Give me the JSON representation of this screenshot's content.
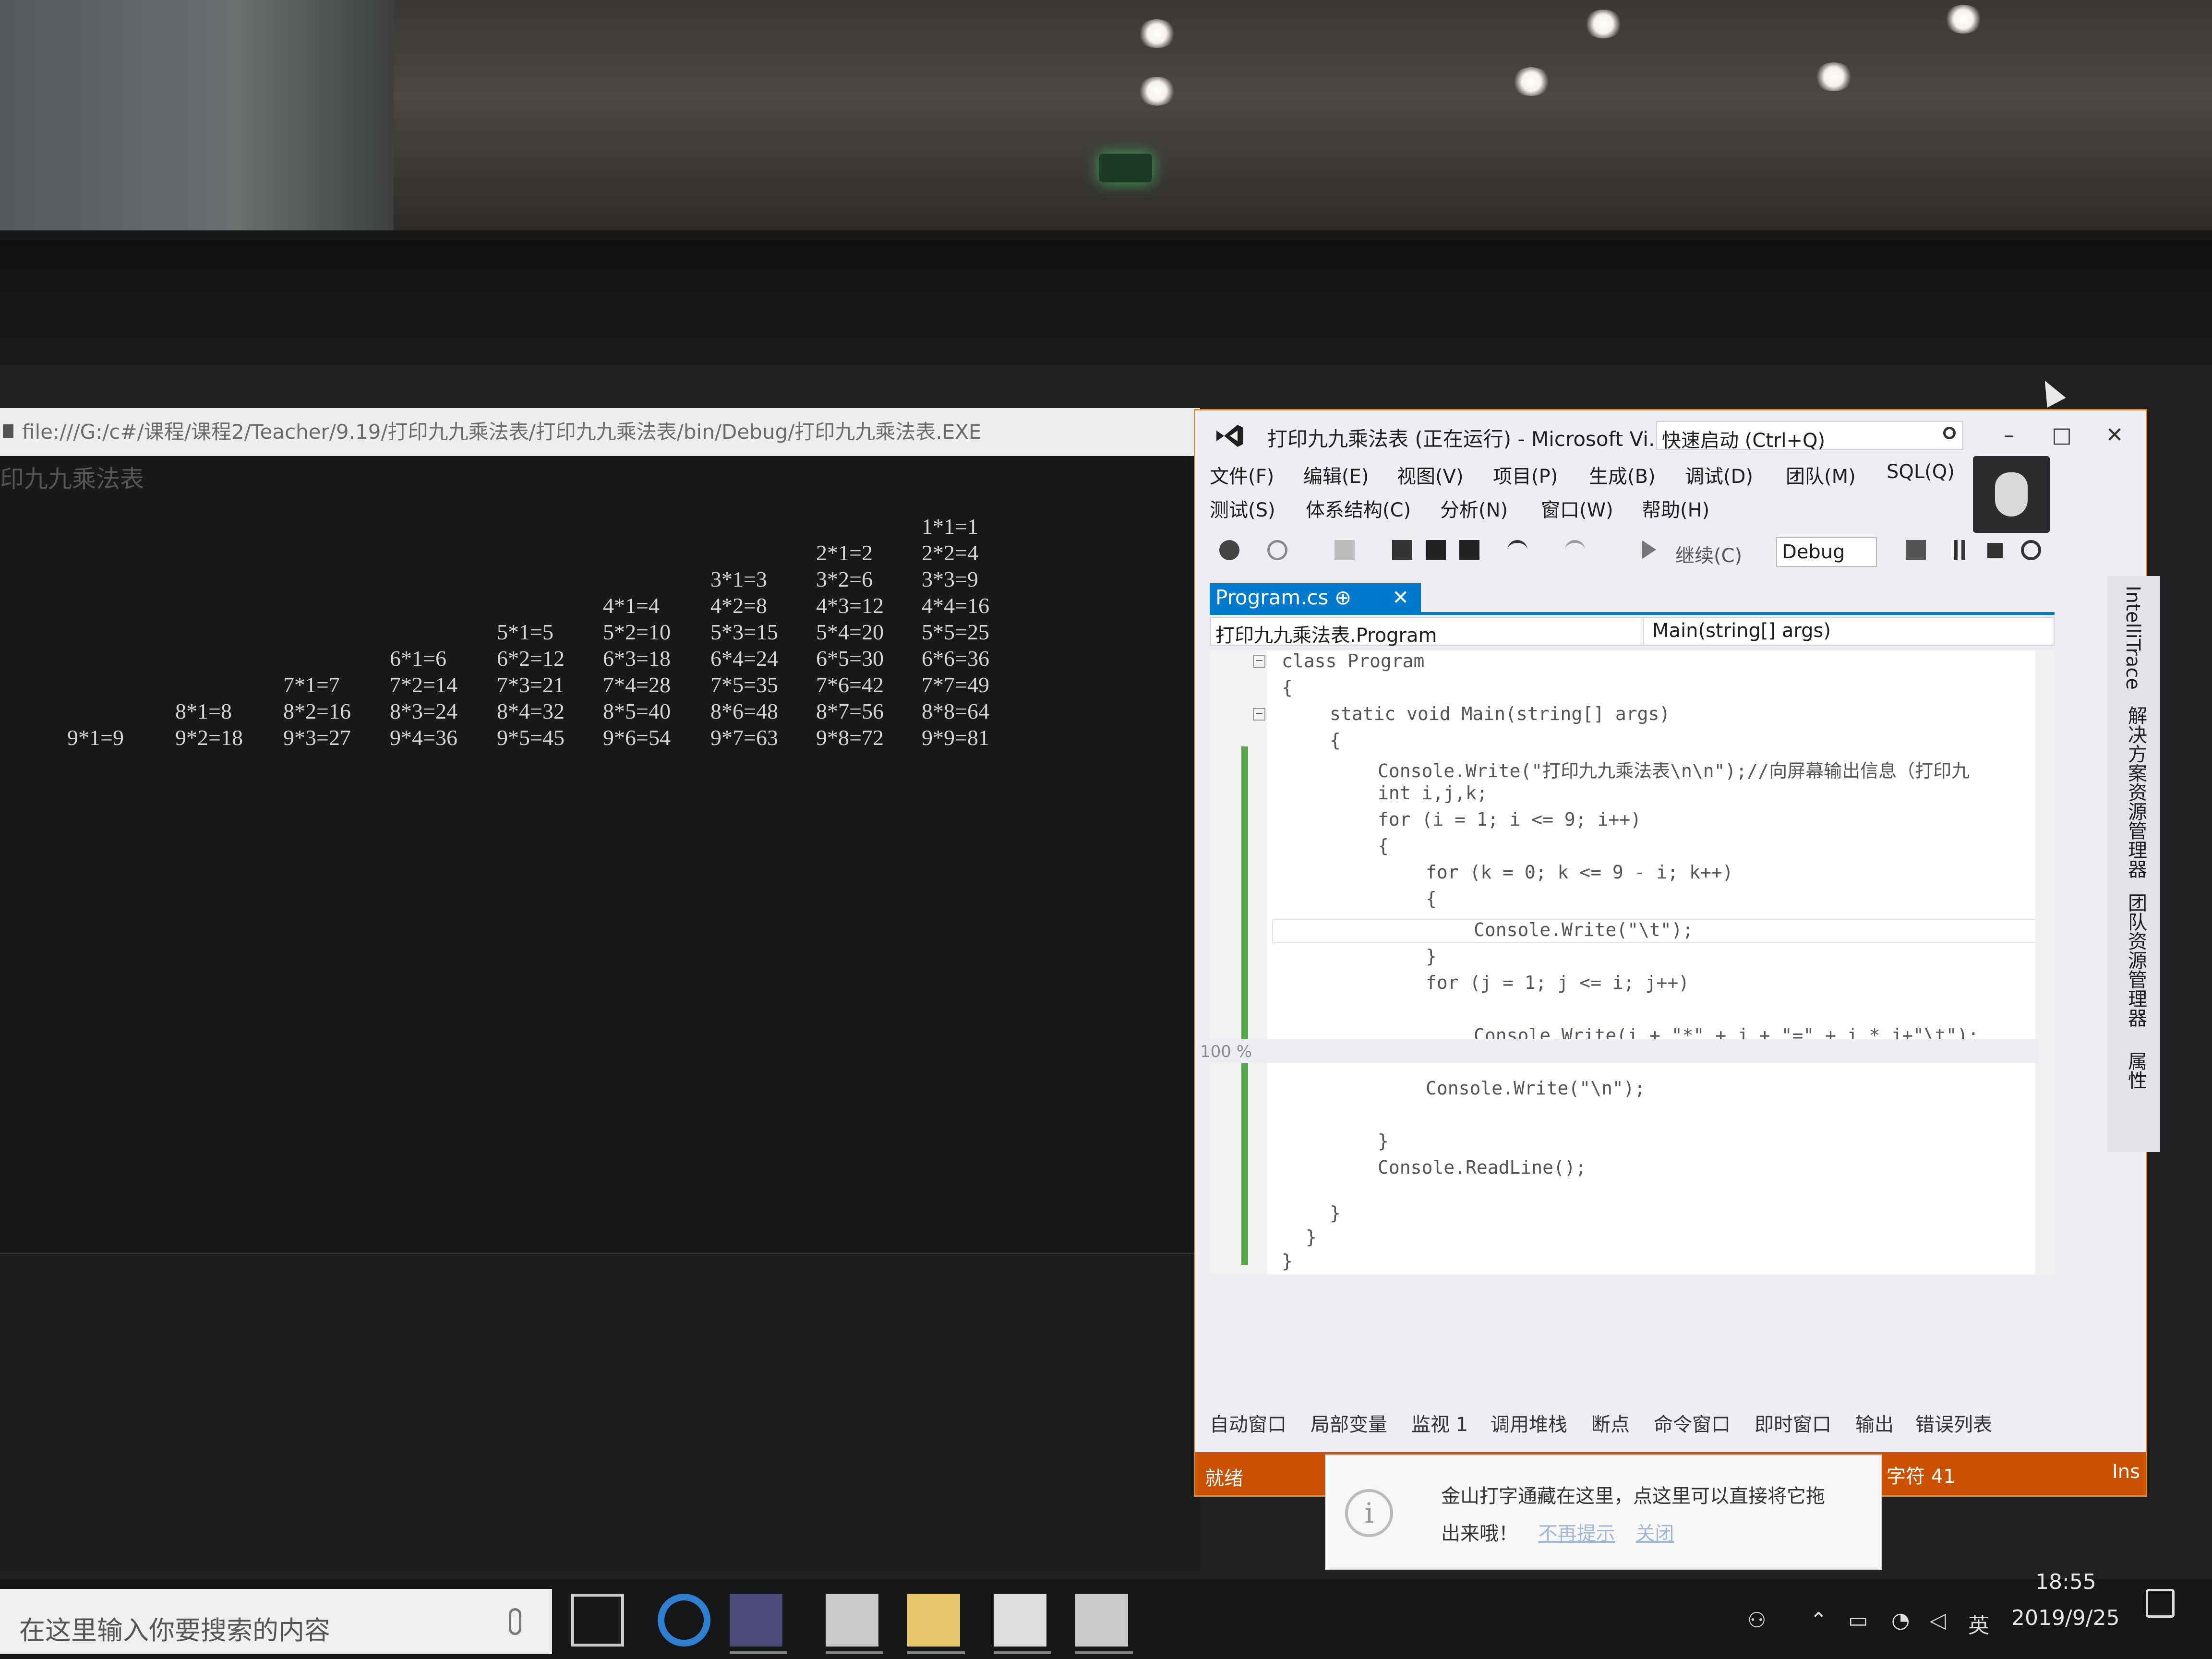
{
  "console": {
    "title": "file:///G:/c#/课程/课程2/Teacher/9.19/打印九九乘法表/打印九九乘法表/bin/Debug/打印九九乘法表.EXE",
    "heading": "印九九乘法表",
    "table": {
      "row1": [
        "1*1=1"
      ],
      "row2": [
        "2*1=2",
        "2*2=4"
      ],
      "row3": [
        "3*1=3",
        "3*2=6",
        "3*3=9"
      ],
      "row4": [
        "4*1=4",
        "4*2=8",
        "4*3=12",
        "4*4=16"
      ],
      "row5": [
        "5*1=5",
        "5*2=10",
        "5*3=15",
        "5*4=20",
        "5*5=25"
      ],
      "row6": [
        "6*1=6",
        "6*2=12",
        "6*3=18",
        "6*4=24",
        "6*5=30",
        "6*6=36"
      ],
      "row7": [
        "7*1=7",
        "7*2=14",
        "7*3=21",
        "7*4=28",
        "7*5=35",
        "7*6=42",
        "7*7=49"
      ],
      "row8": [
        "8*1=8",
        "8*2=16",
        "8*3=24",
        "8*4=32",
        "8*5=40",
        "8*6=48",
        "8*7=56",
        "8*8=64"
      ],
      "row9": [
        "9*1=9",
        "9*2=18",
        "9*3=27",
        "9*4=36",
        "9*5=45",
        "9*6=54",
        "9*7=63",
        "9*8=72",
        "9*9=81"
      ]
    }
  },
  "vs": {
    "title": "打印九九乘法表 (正在运行) - Microsoft Vi...",
    "quick_launch": "快速启动 (Ctrl+Q)",
    "controls": {
      "minimize": "–",
      "maximize": "□",
      "close": "✕"
    },
    "menu_row1": [
      "文件(F)",
      "编辑(E)",
      "视图(V)",
      "项目(P)",
      "生成(B)",
      "调试(D)",
      "团队(M)",
      "SQL(Q)"
    ],
    "menu_row2": [
      "测试(S)",
      "体系结构(C)",
      "分析(N)",
      "窗口(W)",
      "帮助(H)"
    ],
    "toolbar": {
      "continue": "继续(C)",
      "config": "Debug"
    },
    "tab": {
      "label": "Program.cs",
      "pin": "⊕",
      "close": "✕"
    },
    "nav": {
      "left": "打印九九乘法表.Program",
      "right": "Main(string[] args)"
    },
    "code": [
      "class Program",
      "{",
      "static void Main(string[] args)",
      "{",
      "Console.Write(\"打印九九乘法表\\n\\n\");//向屏幕输出信息（打印九",
      "int i,j,k;",
      "for (i = 1; i <= 9; i++)",
      "{",
      "for (k = 0; k <= 9 - i; k++)",
      "{",
      "Console.Write(\"\\t\");",
      "}",
      "for (j = 1; j <= i; j++)",
      "Console.Write(i + \"*\" + j + \"=\" + i * j+\"\\t\");",
      "Console.Write(\"\\n\");",
      "}",
      "Console.ReadLine();",
      "}",
      "}",
      "}"
    ],
    "zoom": "100 %",
    "bottom_tabs": [
      "自动窗口",
      "局部变量",
      "监视 1",
      "调用堆栈",
      "断点",
      "命令窗口",
      "即时窗口",
      "输出",
      "错误列表"
    ],
    "status": {
      "ready": "就绪",
      "char": "字符 41",
      "ins": "Ins"
    },
    "side_labels": [
      "IntelliTrace",
      "解决方案资源管理器",
      "团队资源管理器",
      "属性"
    ]
  },
  "toast": {
    "line1": "金山打字通藏在这里，点这里可以直接将它拖",
    "line2": "出来哦！",
    "link1": "不再提示",
    "link2": "关闭"
  },
  "taskbar": {
    "search_placeholder": "在这里输入你要搜索的内容",
    "tray": {
      "lang": "英"
    },
    "time": "18:55",
    "date": "2019/9/25"
  }
}
